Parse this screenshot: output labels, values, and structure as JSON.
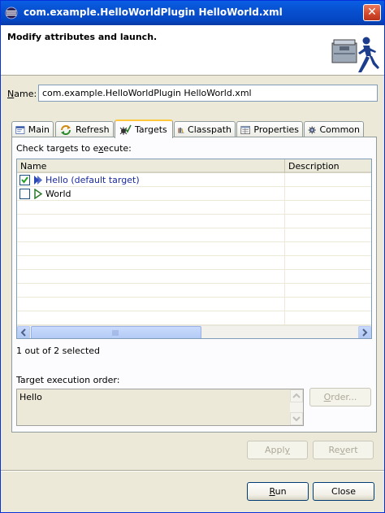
{
  "window": {
    "title": "com.example.HelloWorldPlugin HelloWorld.xml",
    "close_glyph": "✕"
  },
  "header": {
    "message": "Modify attributes and launch."
  },
  "name_field": {
    "label_mnemonic": "N",
    "label_rest": "ame:",
    "value": "com.example.HelloWorldPlugin HelloWorld.xml"
  },
  "tabs": [
    {
      "label": "Main",
      "icon": "main-tab-icon"
    },
    {
      "label": "Refresh",
      "icon": "refresh-icon"
    },
    {
      "label": "Targets",
      "icon": "targets-icon"
    },
    {
      "label": "Classpath",
      "icon": "classpath-icon"
    },
    {
      "label": "Properties",
      "icon": "properties-icon"
    },
    {
      "label": "Common",
      "icon": "common-gear-icon"
    }
  ],
  "active_tab": "Targets",
  "targets_panel": {
    "check_label_pre": "Check targets to e",
    "check_label_mnemonic": "x",
    "check_label_post": "ecute:",
    "columns": [
      "Name",
      "Description"
    ],
    "rows": [
      {
        "name": "Hello (default target)",
        "description": "",
        "checked": true,
        "is_default": true
      },
      {
        "name": "World",
        "description": "",
        "checked": false,
        "is_default": false
      }
    ],
    "selected_count": "1 out of 2 selected",
    "order_label": "Target execution order:",
    "order_text": "Hello",
    "order_button": "Order...",
    "order_button_mnemonic": "O",
    "order_button_rest": "rder..."
  },
  "buttons": {
    "apply_mnemonic": "y",
    "apply_pre": "Appl",
    "revert_mnemonic": "v",
    "revert_pre": "Re",
    "revert_post": "ert",
    "run_mnemonic": "R",
    "run_rest": "un",
    "close": "Close"
  },
  "colors": {
    "titlebar": "#0a5fe4",
    "accent": "#ffc83c",
    "dialog_bg": "#ece9d8",
    "default_target": "#1a2aa0"
  }
}
